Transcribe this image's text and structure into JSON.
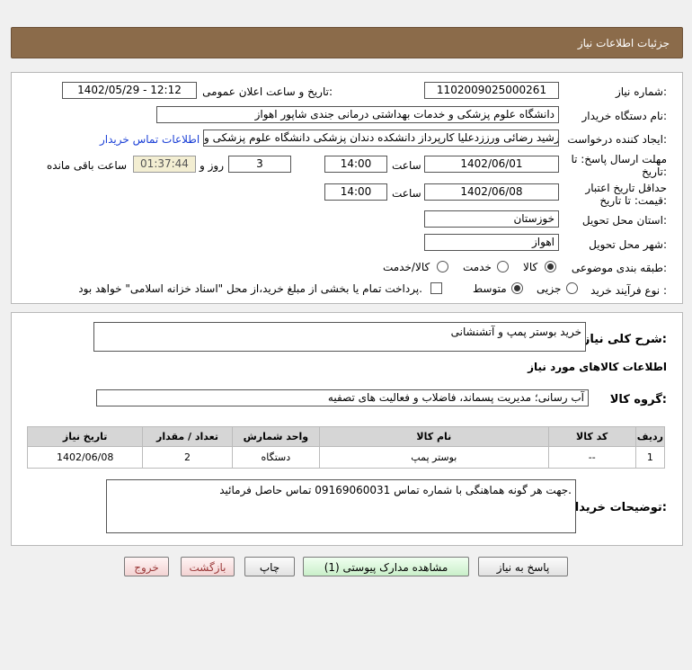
{
  "header": {
    "title": "جزئیات اطلاعات نیاز"
  },
  "form": {
    "need_number_label": "شماره نیاز:",
    "need_number": "1102009025000261",
    "announce_label": "تاریخ و ساعت اعلان عمومی:",
    "announce_value": "1402/05/29 - 12:12",
    "buyer_org_label": "نام دستگاه خریدار:",
    "buyer_org": "دانشگاه علوم پزشکی و خدمات بهداشتی درمانی جندی شاپور اهواز",
    "creator_label": "ایجاد کننده درخواست:",
    "creator": "رشید رضائی ورززدعلیا کارپرداز دانشکده دندان پزشکی دانشگاه علوم پزشکی و",
    "contact_link": "اطلاعات تماس خریدار",
    "reply_deadline_label_1": "مهلت ارسال پاسخ: تا",
    "reply_deadline_label_2": "تاریخ:",
    "reply_date": "1402/06/01",
    "time_label": "ساعت",
    "reply_time": "14:00",
    "days_value": "3",
    "days_label": "روز و",
    "remaining_time": "01:37:44",
    "remaining_label": "ساعت باقی مانده",
    "validity_label_1": "حداقل تاریخ اعتبار",
    "validity_label_2": "قیمت: تا تاریخ:",
    "validity_date": "1402/06/08",
    "validity_time": "14:00",
    "province_label": "استان محل تحویل:",
    "province": "خوزستان",
    "city_label": "شهر محل تحویل:",
    "city": "اهواز",
    "category_label": "طبقه بندی موضوعی:",
    "category_options": [
      "کالا",
      "خدمت",
      "کالا/خدمت"
    ],
    "process_label": "نوع فرآیند خرید :",
    "process_options": [
      "جزیی",
      "متوسط"
    ],
    "payment_note": "پرداخت تمام یا بخشی از مبلغ خرید،از محل \"اسناد خزانه اسلامی\" خواهد بود."
  },
  "summary": {
    "desc_label": "شرح کلی نیاز:",
    "desc_value": "خرید بوستر پمپ و آتشنشانی",
    "goods_info_title": "اطلاعات کالاهای مورد نیاز",
    "group_label": "گروه کالا:",
    "group_value": "آب رسانی؛ مدیریت پسماند، فاضلاب و فعالیت های تصفیه"
  },
  "table": {
    "headers": [
      "ردیف",
      "کد کالا",
      "نام کالا",
      "واحد شمارش",
      "تعداد / مقدار",
      "تاریخ نیاز"
    ],
    "rows": [
      {
        "row": "1",
        "code": "--",
        "name": "بوستر پمپ",
        "unit": "دستگاه",
        "qty": "2",
        "date": "1402/06/08"
      }
    ]
  },
  "buyer_notes": {
    "label": "توضیحات خریدار:",
    "value": "جهت هر گونه هماهنگی با شماره تماس 09169060031 تماس حاصل فرمائید."
  },
  "buttons": {
    "reply": "پاسخ به نیاز",
    "attachments": "مشاهده مدارک پیوستی (1)",
    "print": "چاپ",
    "back": "بازگشت",
    "exit": "خروج"
  }
}
